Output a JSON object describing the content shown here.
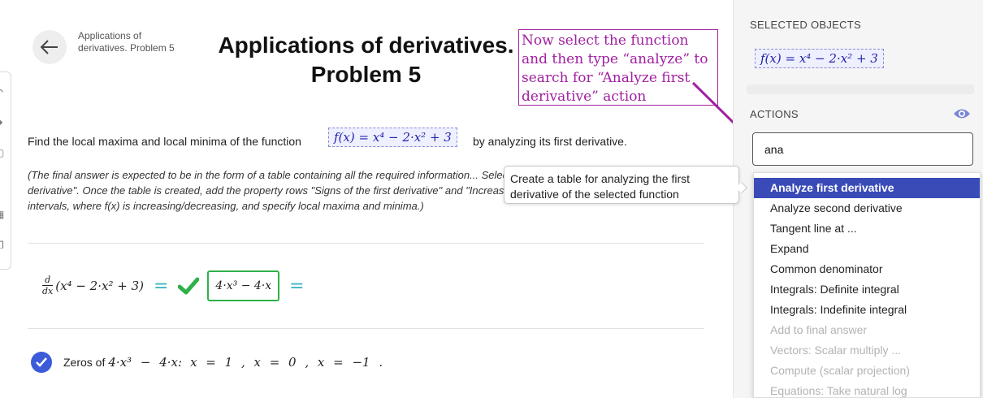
{
  "header": {
    "breadcrumb": "Applications of derivatives. Problem 5",
    "title": "Applications of derivatives. Problem 5"
  },
  "annotation": {
    "text": "Now select the function and then type “analyze” to search for “Analyze first derivative” action",
    "color": "#a020a0"
  },
  "problem": {
    "text_before": "Find the local maxima and local minima of the function",
    "function": "f(x) = x⁴ − 2·x² + 3",
    "text_after": "by analyzing its first derivative.",
    "instructions": "(The final answer is expected to be in the form of a table containing all the required information... Select f(x) and choose \"Analyze first derivative\". Once the table is created, add the property rows \"Signs of the first derivative\" and \"Increase/decrease of the function\", add intervals, where f(x) is increasing/decreasing, and specify local maxima and minima.)"
  },
  "derivation": {
    "operator_num": "d",
    "operator_den": "dx",
    "expression": "(x⁴ − 2·x² + 3)",
    "equals_1": "=",
    "result": "4·x³ − 4·x",
    "equals_2": "="
  },
  "zeros": {
    "label": "Zeros of",
    "expression": "4·x³ − 4·x:",
    "roots": "x = 1 ,  x = 0 ,  x = −1 ."
  },
  "tooltip": {
    "text": "Create a table for analyzing the first derivative of the selected function"
  },
  "panel": {
    "selected_objects_label": "SELECTED OBJECTS",
    "selected_object": "f(x) = x⁴ − 2·x² + 3",
    "actions_label": "ACTIONS",
    "search_value": "ana",
    "menu": [
      {
        "label": "Analyze first derivative",
        "state": "selected"
      },
      {
        "label": "Analyze second derivative",
        "state": "normal"
      },
      {
        "label": "Tangent line at ...",
        "state": "normal"
      },
      {
        "label": "Expand",
        "state": "normal"
      },
      {
        "label": "Common denominator",
        "state": "normal"
      },
      {
        "label": "Integrals: Definite integral",
        "state": "normal"
      },
      {
        "label": "Integrals: Indefinite integral",
        "state": "normal"
      },
      {
        "label": "Add to final answer",
        "state": "disabled"
      },
      {
        "label": "Vectors: Scalar multiply ...",
        "state": "disabled"
      },
      {
        "label": "Compute (scalar projection)",
        "state": "disabled"
      },
      {
        "label": "Equations: Take natural log",
        "state": "disabled"
      }
    ]
  },
  "colors": {
    "accent": "#3a4bb8",
    "check": "#2fb14a",
    "equals": "#3fb4c4",
    "eye": "#7a86d9"
  },
  "icons": [
    "arrow-left-icon",
    "check-icon",
    "check-circle-icon",
    "eye-icon"
  ]
}
